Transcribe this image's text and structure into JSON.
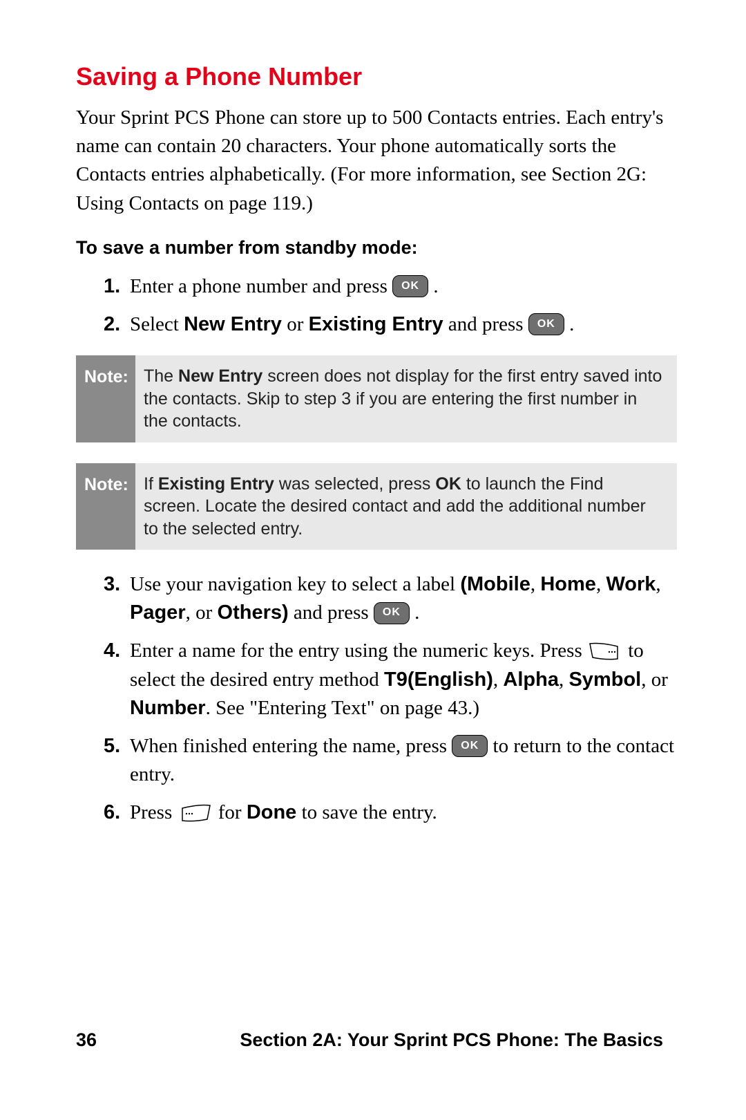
{
  "heading": "Saving a Phone Number",
  "intro": "Your Sprint PCS Phone can store up to 500 Contacts entries. Each entry's name can contain 20 characters. Your phone automatically sorts the Contacts entries alphabetically. (For more information, see Section 2G: Using Contacts on page 119.)",
  "subhead": "To save a number from standby mode:",
  "steps": {
    "s1_num": "1.",
    "s1_a": "Enter a phone number and press ",
    "s1_b": " .",
    "s2_num": "2.",
    "s2_a": "Select ",
    "s2_b": "New Entry",
    "s2_c": " or ",
    "s2_d": "Existing Entry",
    "s2_e": " and press ",
    "s2_f": " .",
    "s3_num": "3.",
    "s3_a": "Use your navigation key to select a label ",
    "s3_b": "(Mobile",
    "s3_c": ", ",
    "s3_d": "Home",
    "s3_e": ", ",
    "s3_f": "Work",
    "s3_g": ", ",
    "s3_h": "Pager",
    "s3_i": ", or ",
    "s3_j": "Others)",
    "s3_k": " and press ",
    "s3_l": " .",
    "s4_num": "4.",
    "s4_a": "Enter a name for the entry using the numeric keys. Press ",
    "s4_b": " to select the desired entry method ",
    "s4_c": "T9(English)",
    "s4_d": ", ",
    "s4_e": "Alpha",
    "s4_f": ", ",
    "s4_g": "Symbol",
    "s4_h": ", or ",
    "s4_i": "Number",
    "s4_j": ". See \"Entering Text\" on page 43.)",
    "s5_num": "5.",
    "s5_a": "When finished entering the name, press ",
    "s5_b": " to return to the contact entry.",
    "s6_num": "6.",
    "s6_a": "Press ",
    "s6_b": " for ",
    "s6_c": "Done",
    "s6_d": " to save the entry."
  },
  "notes": {
    "label": "Note:",
    "n1_a": "The ",
    "n1_b": "New Entry",
    "n1_c": " screen does not display for the first entry saved into the contacts. Skip to step 3 if you are entering the first number in the contacts.",
    "n2_a": "If ",
    "n2_b": "Existing Entry",
    "n2_c": " was selected, press ",
    "n2_d": "OK",
    "n2_e": " to launch the Find screen. Locate the desired contact and add the additional number to the selected entry."
  },
  "ok_label": "OK",
  "footer": {
    "page": "36",
    "section": "Section 2A: Your Sprint PCS Phone: The Basics"
  }
}
